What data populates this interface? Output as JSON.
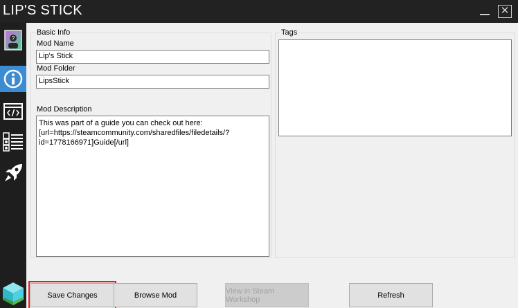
{
  "window": {
    "title": "LIP'S STICK",
    "close_glyph": "✕"
  },
  "sidebar": {
    "items": [
      {
        "name": "mod-preview-icon",
        "active": false
      },
      {
        "name": "info-icon",
        "active": true
      },
      {
        "name": "code-icon",
        "active": false
      },
      {
        "name": "list-icon",
        "active": false
      },
      {
        "name": "rocket-icon",
        "active": false
      },
      {
        "name": "cube-icon",
        "active": false
      }
    ],
    "active_color": "#3b8cd2"
  },
  "basic_info": {
    "legend": "Basic Info",
    "mod_name_label": "Mod Name",
    "mod_name_value": "Lip's Stick",
    "mod_folder_label": "Mod Folder",
    "mod_folder_value": "LipsStick",
    "mod_description_label": "Mod Description",
    "mod_description_value": "This was part of a guide you can check out here: [url=https://steamcommunity.com/sharedfiles/filedetails/?id=1778166971]Guide[/url]"
  },
  "tags": {
    "legend": "Tags",
    "value": ""
  },
  "actions": {
    "save_label": "Save Changes",
    "browse_label": "Browse Mod",
    "workshop_label": "View in Steam Workshop",
    "refresh_label": "Refresh",
    "highlight_color": "#e02020"
  }
}
